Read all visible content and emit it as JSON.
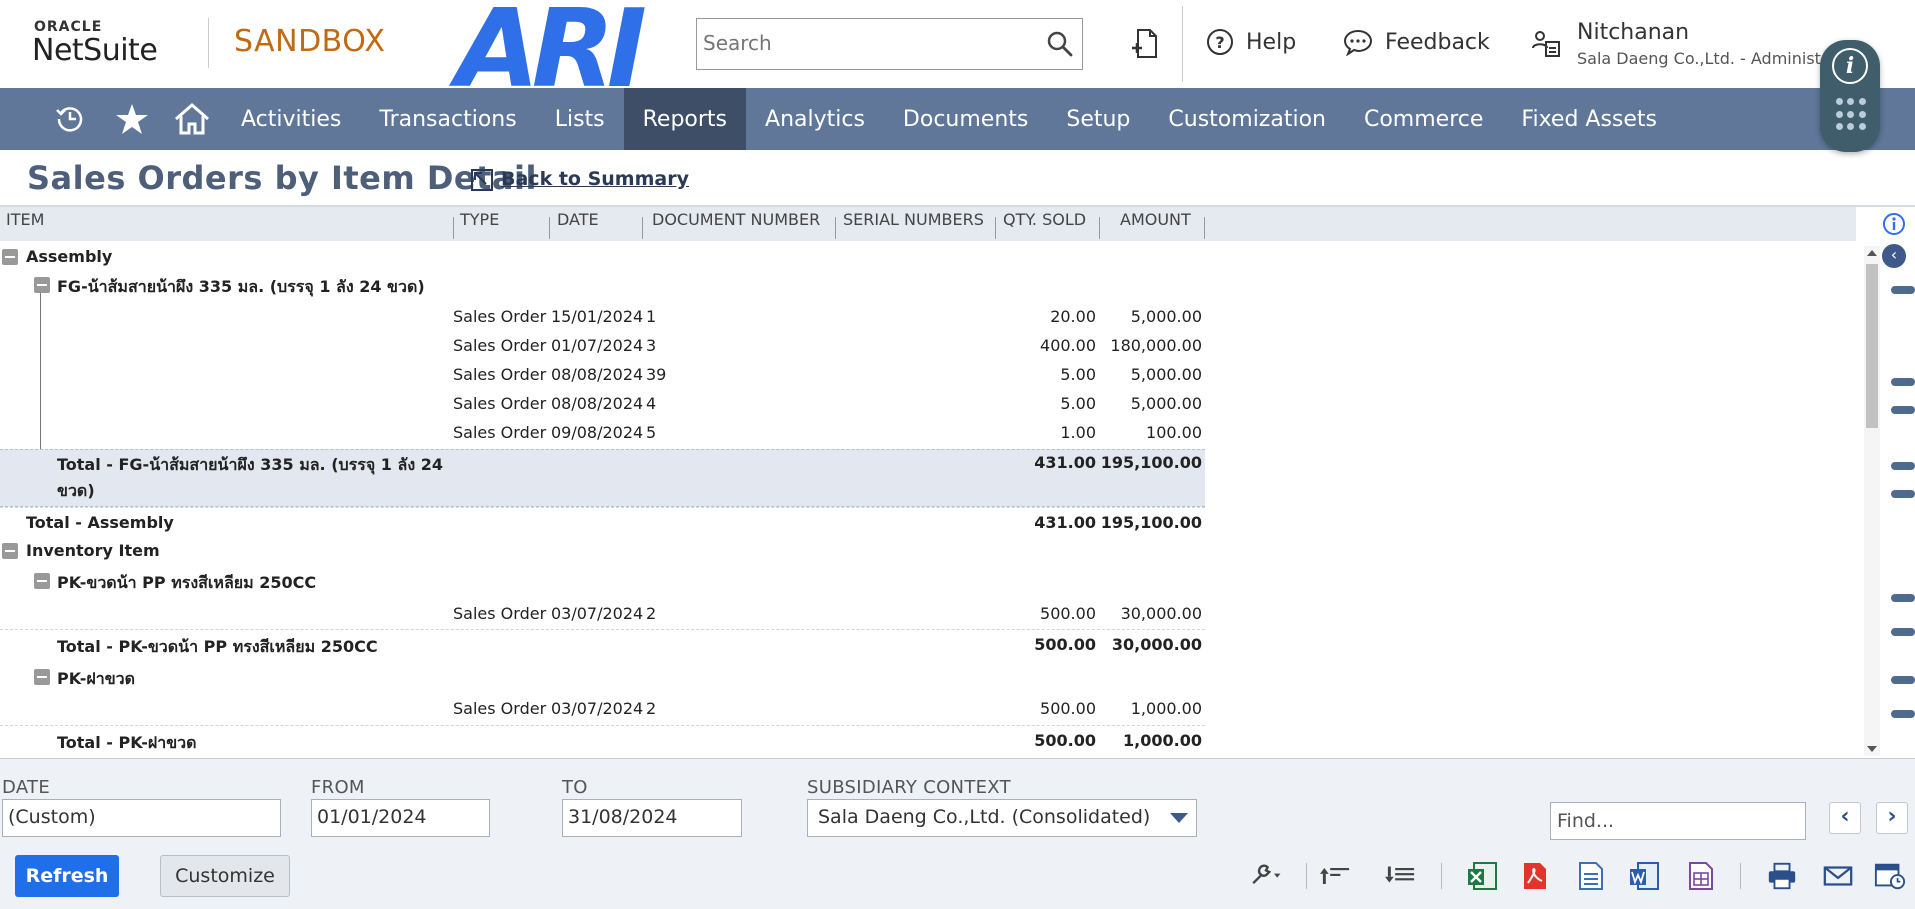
{
  "header": {
    "oracle_label": "ORACLE",
    "netsuite_label": "NetSuite",
    "env_label": "SANDBOX",
    "company_logo_text": "ARI",
    "search_placeholder": "Search",
    "help_label": "Help",
    "feedback_label": "Feedback",
    "user_name": "Nitchanan",
    "user_subtitle": "Sala Daeng Co.,Ltd. - Administrator"
  },
  "nav": {
    "items": [
      "Activities",
      "Transactions",
      "Lists",
      "Reports",
      "Analytics",
      "Documents",
      "Setup",
      "Customization",
      "Commerce",
      "Fixed Assets"
    ],
    "active": "Reports"
  },
  "page": {
    "title": "Sales Orders by Item Detail",
    "back_link": "Back to Summary"
  },
  "report": {
    "columns": [
      "ITEM",
      "TYPE",
      "DATE",
      "DOCUMENT NUMBER",
      "SERIAL NUMBERS",
      "QTY. SOLD",
      "AMOUNT"
    ],
    "rows": [
      {
        "kind": "group",
        "label": "Assembly"
      },
      {
        "kind": "subgroup",
        "label": "FG-น้าส้มสายน้าผึง 335 มล. (บรรจุ 1 ลัง 24 ขวด)"
      },
      {
        "kind": "detail",
        "type": "Sales Order",
        "date": "15/01/2024",
        "doc": "1",
        "qty": "20.00",
        "amount": "5,000.00"
      },
      {
        "kind": "detail",
        "type": "Sales Order",
        "date": "01/07/2024",
        "doc": "3",
        "qty": "400.00",
        "amount": "180,000.00"
      },
      {
        "kind": "detail",
        "type": "Sales Order",
        "date": "08/08/2024",
        "doc": "39",
        "qty": "5.00",
        "amount": "5,000.00"
      },
      {
        "kind": "detail",
        "type": "Sales Order",
        "date": "08/08/2024",
        "doc": "4",
        "qty": "5.00",
        "amount": "5,000.00"
      },
      {
        "kind": "detail",
        "type": "Sales Order",
        "date": "09/08/2024",
        "doc": "5",
        "qty": "1.00",
        "amount": "100.00"
      },
      {
        "kind": "subtotal",
        "label_line1": "Total - FG-น้าส้มสายน้าผึง 335 มล. (บรรจุ 1 ลัง 24",
        "label_line2": "ขวด)",
        "qty": "431.00",
        "amount": "195,100.00"
      },
      {
        "kind": "grouptotal",
        "label": "Total - Assembly",
        "qty": "431.00",
        "amount": "195,100.00"
      },
      {
        "kind": "group",
        "label": "Inventory Item"
      },
      {
        "kind": "subgroup",
        "label": "PK-ขวดน้า PP ทรงสีเหลียม 250CC"
      },
      {
        "kind": "detail",
        "type": "Sales Order",
        "date": "03/07/2024",
        "doc": "2",
        "qty": "500.00",
        "amount": "30,000.00"
      },
      {
        "kind": "subtotal2",
        "label": "Total - PK-ขวดน้า PP ทรงสีเหลียม 250CC",
        "qty": "500.00",
        "amount": "30,000.00"
      },
      {
        "kind": "subgroup",
        "label": "PK-ฝาขวด"
      },
      {
        "kind": "detail",
        "type": "Sales Order",
        "date": "03/07/2024",
        "doc": "2",
        "qty": "500.00",
        "amount": "1,000.00"
      },
      {
        "kind": "subtotal2",
        "label": "Total - PK-ฝาขวด",
        "qty": "500.00",
        "amount": "1,000.00"
      }
    ]
  },
  "filters": {
    "date_label": "DATE",
    "date_value": "(Custom)",
    "from_label": "FROM",
    "from_value": "01/01/2024",
    "to_label": "TO",
    "to_value": "31/08/2024",
    "subsidiary_label": "SUBSIDIARY CONTEXT",
    "subsidiary_value": "Sala Daeng Co.,Ltd. (Consolidated)",
    "find_placeholder": "Find..."
  },
  "buttons": {
    "refresh": "Refresh",
    "customize": "Customize"
  },
  "colors": {
    "nav_bg": "#607799",
    "nav_active": "#3d4e66",
    "brand_blue": "#2f6fe8",
    "sandbox_orange": "#c06a13",
    "refresh_blue": "#1f6feb"
  }
}
